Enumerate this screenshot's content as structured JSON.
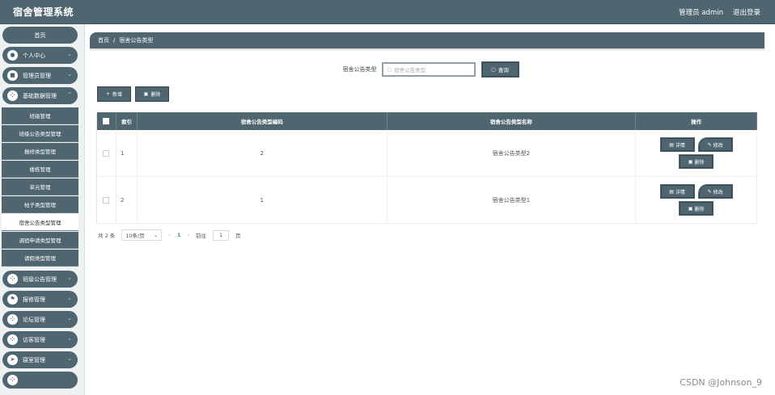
{
  "app": {
    "title": "宿舍管理系统",
    "user_label": "管理员 admin",
    "logout": "退出登录"
  },
  "sidebar": {
    "home": "首页",
    "groups_top": [
      {
        "label": "个人中心",
        "icon": "user-icon"
      },
      {
        "label": "管理员管理",
        "icon": "admin-icon"
      },
      {
        "label": "基础数据管理",
        "icon": "grid-icon"
      }
    ],
    "sub_items": [
      {
        "label": "班级管理"
      },
      {
        "label": "班级公告类型管理"
      },
      {
        "label": "报修类型管理"
      },
      {
        "label": "楼栋管理"
      },
      {
        "label": "单元管理"
      },
      {
        "label": "帖子类型管理"
      },
      {
        "label": "宿舍公告类型管理",
        "active": true
      },
      {
        "label": "调宿申请类型管理"
      },
      {
        "label": "请假类型管理"
      }
    ],
    "groups_bottom": [
      {
        "label": "班级公告管理",
        "icon": "grid-icon"
      },
      {
        "label": "报修管理",
        "icon": "flag-icon"
      },
      {
        "label": "论坛管理",
        "icon": "grid-icon"
      },
      {
        "label": "访客管理",
        "icon": "grid-icon"
      },
      {
        "label": "寝室管理",
        "icon": "send-icon"
      }
    ]
  },
  "breadcrumb": {
    "home": "首页",
    "separator": "/",
    "current": "宿舍公告类型"
  },
  "search": {
    "label": "宿舍公告类型",
    "placeholder": "宿舍公告类型",
    "button": "查询"
  },
  "actions": {
    "add": "新增",
    "delete": "删除"
  },
  "table": {
    "headers": {
      "index": "索引",
      "code": "宿舍公告类型编码",
      "name": "宿舍公告类型名称",
      "ops": "操作"
    },
    "rows": [
      {
        "index": "1",
        "code": "2",
        "name": "宿舍公告类型2"
      },
      {
        "index": "2",
        "code": "1",
        "name": "宿舍公告类型1"
      }
    ],
    "op_labels": {
      "detail": "详情",
      "edit": "修改",
      "delete": "删除"
    }
  },
  "pagination": {
    "total": "共 2 条",
    "page_size": "10条/页",
    "prev": "‹",
    "current_page": "1",
    "next": "›",
    "goto_label": "前往",
    "goto_value": "1",
    "page_unit": "页"
  },
  "watermark": "CSDN @Johnson_9",
  "colors": {
    "primary": "#4f6670",
    "background": "#eef1f2"
  }
}
